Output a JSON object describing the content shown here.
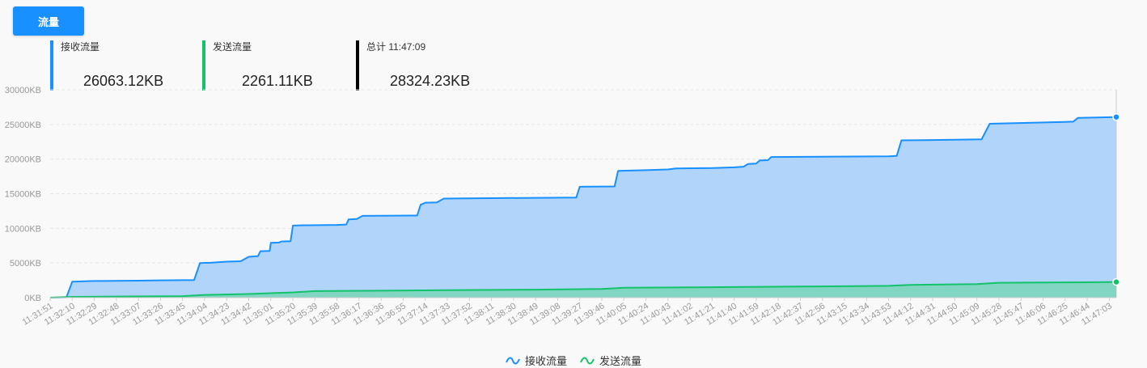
{
  "tabs": {
    "flow_label": "流量"
  },
  "stats": {
    "received": {
      "label": "接收流量",
      "value": "26063.12KB",
      "color": "#1890ff"
    },
    "sent": {
      "label": "发送流量",
      "value": "2261.11KB",
      "color": "#13c26b"
    },
    "total": {
      "label": "总计 11:47:09",
      "value": "28324.23KB",
      "color": "#000000"
    }
  },
  "chart_data": {
    "type": "area",
    "y_ticks": [
      "0KB",
      "5000KB",
      "10000KB",
      "15000KB",
      "20000KB",
      "25000KB",
      "30000KB"
    ],
    "ylim": [
      0,
      30000
    ],
    "y_unit": "KB",
    "x_tick_labels": [
      "11:31:51",
      "11:32:10",
      "11:32:29",
      "11:32:48",
      "11:33:07",
      "11:33:26",
      "11:33:45",
      "11:34:04",
      "11:34:23",
      "11:34:42",
      "11:35:01",
      "11:35:20",
      "11:35:39",
      "11:35:58",
      "11:36:17",
      "11:36:36",
      "11:36:55",
      "11:37:14",
      "11:37:33",
      "11:37:52",
      "11:38:11",
      "11:38:30",
      "11:38:49",
      "11:39:08",
      "11:39:27",
      "11:39:46",
      "11:40:05",
      "11:40:24",
      "11:40:43",
      "11:41:02",
      "11:41:21",
      "11:41:40",
      "11:41:59",
      "11:42:18",
      "11:42:37",
      "11:42:56",
      "11:43:15",
      "11:43:34",
      "11:43:53",
      "11:44:12",
      "11:44:31",
      "11:44:50",
      "11:45:09",
      "11:45:28",
      "11:45:47",
      "11:46:06",
      "11:46:25",
      "11:46:44",
      "11:47:03"
    ],
    "grid": "horizontal dashed",
    "legend_position": "bottom-center",
    "series": [
      {
        "name": "接收流量",
        "color": "#1890ff",
        "fill": "#a8cffb",
        "points": [
          [
            "11:31:51",
            0
          ],
          [
            "11:32:05",
            50
          ],
          [
            "11:32:10",
            2300
          ],
          [
            "11:32:29",
            2400
          ],
          [
            "11:33:07",
            2450
          ],
          [
            "11:33:26",
            2500
          ],
          [
            "11:33:55",
            2550
          ],
          [
            "11:34:00",
            5000
          ],
          [
            "11:34:10",
            5050
          ],
          [
            "11:34:23",
            5200
          ],
          [
            "11:34:35",
            5250
          ],
          [
            "11:34:42",
            5900
          ],
          [
            "11:34:50",
            6000
          ],
          [
            "11:34:52",
            6700
          ],
          [
            "11:35:00",
            6750
          ],
          [
            "11:35:01",
            7900
          ],
          [
            "11:35:08",
            7950
          ],
          [
            "11:35:10",
            8100
          ],
          [
            "11:35:18",
            8150
          ],
          [
            "11:35:20",
            10400
          ],
          [
            "11:35:30",
            10450
          ],
          [
            "11:35:58",
            10500
          ],
          [
            "11:36:06",
            10550
          ],
          [
            "11:36:08",
            11300
          ],
          [
            "11:36:15",
            11350
          ],
          [
            "11:36:20",
            11800
          ],
          [
            "11:37:07",
            11850
          ],
          [
            "11:37:10",
            13400
          ],
          [
            "11:37:14",
            13700
          ],
          [
            "11:37:24",
            13750
          ],
          [
            "11:37:30",
            14300
          ],
          [
            "11:38:49",
            14400
          ],
          [
            "11:39:24",
            14450
          ],
          [
            "11:39:27",
            16000
          ],
          [
            "11:39:57",
            16050
          ],
          [
            "11:40:00",
            18300
          ],
          [
            "11:40:24",
            18400
          ],
          [
            "11:40:43",
            18500
          ],
          [
            "11:40:50",
            18650
          ],
          [
            "11:41:21",
            18700
          ],
          [
            "11:41:40",
            18800
          ],
          [
            "11:41:48",
            18900
          ],
          [
            "11:41:52",
            19300
          ],
          [
            "11:41:59",
            19350
          ],
          [
            "11:42:02",
            19800
          ],
          [
            "11:42:09",
            19850
          ],
          [
            "11:42:12",
            20300
          ],
          [
            "11:43:53",
            20400
          ],
          [
            "11:44:00",
            20450
          ],
          [
            "11:44:04",
            22700
          ],
          [
            "11:44:31",
            22750
          ],
          [
            "11:44:50",
            22800
          ],
          [
            "11:45:13",
            22850
          ],
          [
            "11:45:20",
            25100
          ],
          [
            "11:46:25",
            25350
          ],
          [
            "11:46:32",
            25400
          ],
          [
            "11:46:36",
            25950
          ],
          [
            "11:47:09",
            26063.12
          ]
        ]
      },
      {
        "name": "发送流量",
        "color": "#13c26b",
        "fill": "#7dd6bd",
        "points": [
          [
            "11:31:51",
            0
          ],
          [
            "11:32:10",
            120
          ],
          [
            "11:33:45",
            220
          ],
          [
            "11:34:04",
            400
          ],
          [
            "11:34:42",
            520
          ],
          [
            "11:35:20",
            760
          ],
          [
            "11:35:39",
            950
          ],
          [
            "11:36:36",
            1000
          ],
          [
            "11:37:33",
            1080
          ],
          [
            "11:38:49",
            1160
          ],
          [
            "11:39:46",
            1250
          ],
          [
            "11:40:05",
            1420
          ],
          [
            "11:41:21",
            1500
          ],
          [
            "11:42:37",
            1600
          ],
          [
            "11:43:53",
            1700
          ],
          [
            "11:44:12",
            1850
          ],
          [
            "11:45:09",
            1950
          ],
          [
            "11:45:28",
            2150
          ],
          [
            "11:46:44",
            2220
          ],
          [
            "11:47:09",
            2261.11
          ]
        ]
      }
    ]
  }
}
